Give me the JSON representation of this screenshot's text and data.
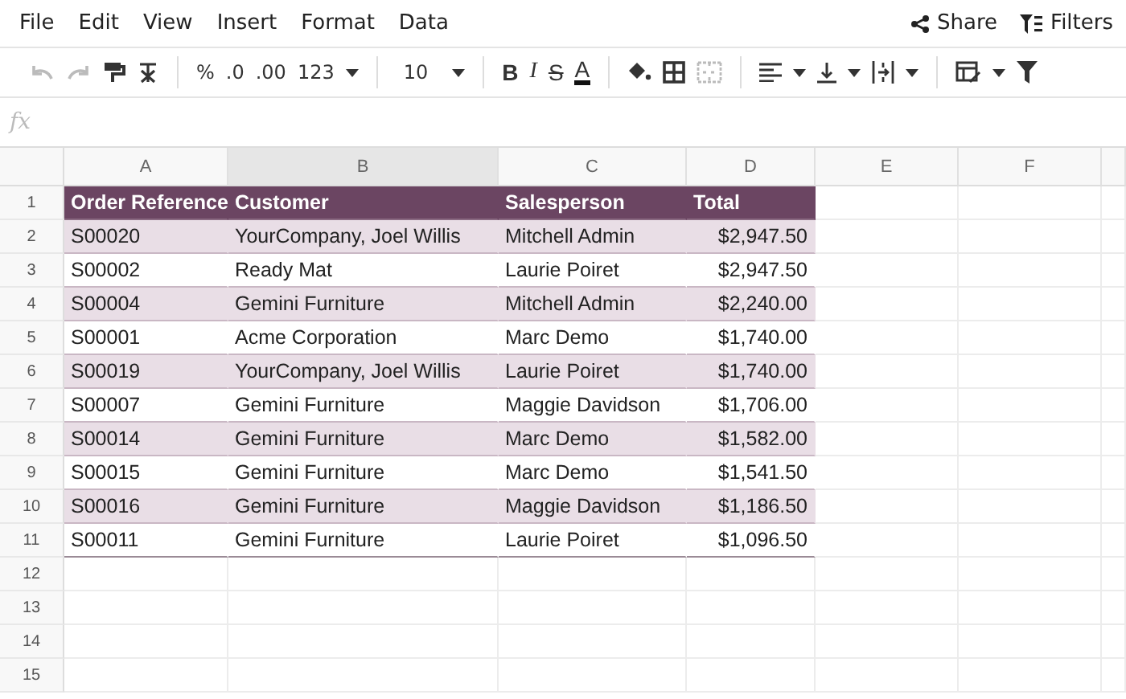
{
  "menu": [
    "File",
    "Edit",
    "View",
    "Insert",
    "Format",
    "Data"
  ],
  "share": "Share",
  "filters": "Filters",
  "toolbar": {
    "undo_disabled": true,
    "redo_disabled": true,
    "format_labels": [
      ".0",
      ".00",
      "123"
    ],
    "percent": "%",
    "font_size": "10",
    "style_letters": [
      "B",
      "I",
      "S",
      "A"
    ],
    "merge_disabled": true
  },
  "formula_bar": {
    "placeholder": "fx"
  },
  "columns": [
    {
      "letter": "A",
      "selected": false,
      "numeric": false
    },
    {
      "letter": "B",
      "selected": true,
      "numeric": false
    },
    {
      "letter": "C",
      "selected": false,
      "numeric": false
    },
    {
      "letter": "D",
      "selected": false,
      "numeric": true
    },
    {
      "letter": "E",
      "selected": false
    },
    {
      "letter": "F",
      "selected": false
    }
  ],
  "rows": [
    {
      "number": "1",
      "kind": "header",
      "cells": [
        "Order Reference",
        "Customer",
        "Salesperson",
        "Total"
      ]
    },
    {
      "number": "2",
      "kind": "data",
      "shaded": true,
      "cells": [
        "S00020",
        "YourCompany, Joel Willis",
        "Mitchell Admin",
        "$2,947.50"
      ]
    },
    {
      "number": "3",
      "kind": "data",
      "shaded": false,
      "cells": [
        "S00002",
        "Ready Mat",
        "Laurie Poiret",
        "$2,947.50"
      ]
    },
    {
      "number": "4",
      "kind": "data",
      "shaded": true,
      "cells": [
        "S00004",
        "Gemini Furniture",
        "Mitchell Admin",
        "$2,240.00"
      ]
    },
    {
      "number": "5",
      "kind": "data",
      "shaded": false,
      "cells": [
        "S00001",
        "Acme Corporation",
        "Marc Demo",
        "$1,740.00"
      ]
    },
    {
      "number": "6",
      "kind": "data",
      "shaded": true,
      "cells": [
        "S00019",
        "YourCompany, Joel Willis",
        "Laurie Poiret",
        "$1,740.00"
      ]
    },
    {
      "number": "7",
      "kind": "data",
      "shaded": false,
      "cells": [
        "S00007",
        "Gemini Furniture",
        "Maggie Davidson",
        "$1,706.00"
      ]
    },
    {
      "number": "8",
      "kind": "data",
      "shaded": true,
      "cells": [
        "S00014",
        "Gemini Furniture",
        "Marc Demo",
        "$1,582.00"
      ]
    },
    {
      "number": "9",
      "kind": "data",
      "shaded": false,
      "cells": [
        "S00015",
        "Gemini Furniture",
        "Marc Demo",
        "$1,541.50"
      ]
    },
    {
      "number": "10",
      "kind": "data",
      "shaded": true,
      "cells": [
        "S00016",
        "Gemini Furniture",
        "Maggie Davidson",
        "$1,186.50"
      ]
    },
    {
      "number": "11",
      "kind": "data",
      "shaded": false,
      "cells": [
        "S00011",
        "Gemini Furniture",
        "Laurie Poiret",
        "$1,096.50"
      ]
    },
    {
      "number": "12",
      "kind": "empty"
    },
    {
      "number": "13",
      "kind": "empty"
    },
    {
      "number": "14",
      "kind": "empty"
    },
    {
      "number": "15",
      "kind": "empty"
    }
  ]
}
